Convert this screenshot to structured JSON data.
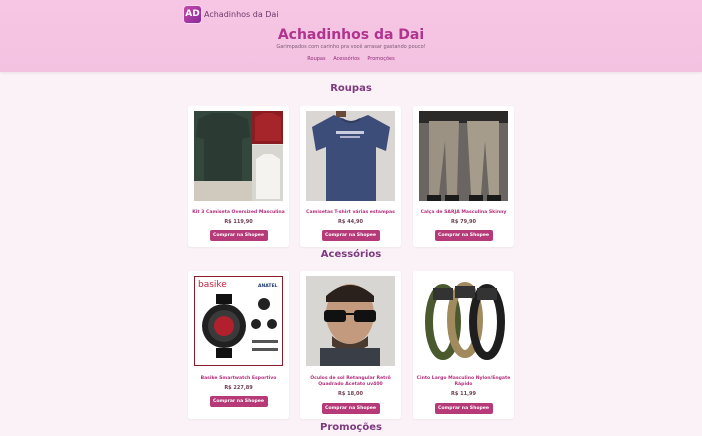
{
  "logo": {
    "badge": "AD",
    "text": "Achadinhos da Dai"
  },
  "title": "Achadinhos da Dai",
  "tagline": "Garimpados com carinho pra você arrasar gastando pouco!",
  "nav": [
    "Roupas",
    "Acessórios",
    "Promoções"
  ],
  "sections": {
    "roupas": {
      "title": "Roupas",
      "products": [
        {
          "name": "Kit 3 Camiseta Oversized Masculina",
          "price": "R$ 119,90",
          "button": "Comprar na Shopee"
        },
        {
          "name": "Camisetas T-shirt várias estampas",
          "price": "R$ 44,90",
          "button": "Comprar na Shopee"
        },
        {
          "name": "Calça de SARJA Masculina Skinny",
          "price": "R$ 79,90",
          "button": "Comprar na Shopee"
        }
      ]
    },
    "acessorios": {
      "title": "Acessórios",
      "products": [
        {
          "name": "Basike Smartwatch Esportivo",
          "price": "R$ 227,89",
          "button": "Comprar na Shopee",
          "img_brand": "basike",
          "img_seal": "ANATEL"
        },
        {
          "name": "Óculos de sol Retangular Retrô Quadrado Acetato uv400",
          "price": "R$ 18,00",
          "button": "Comprar na Shopee"
        },
        {
          "name": "Cinto Largo Masculino Nylon/Engate Rápido",
          "price": "R$ 11,99",
          "button": "Comprar na Shopee"
        }
      ]
    },
    "promocoes": {
      "title": "Promoções"
    }
  },
  "colors": {
    "header_bg": "#f6c6e4",
    "accent": "#b0348e",
    "button": "#b63a78",
    "page_bg": "#fbf2f8"
  }
}
